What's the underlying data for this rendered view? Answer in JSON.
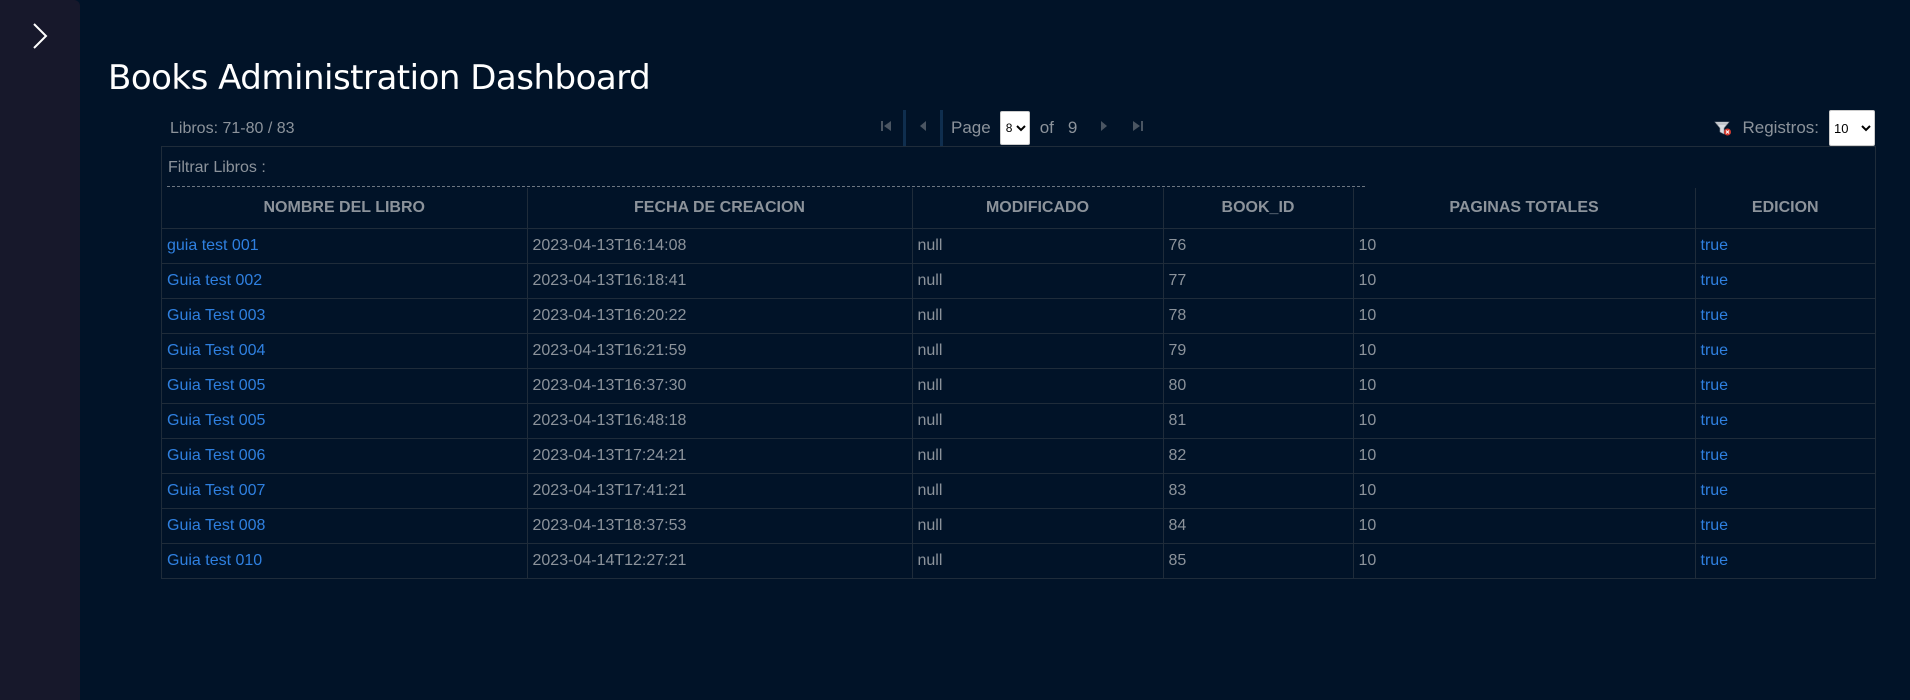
{
  "title": "Books Administration Dashboard",
  "toolbar": {
    "count_label": "Libros: 71-80 / 83",
    "page_label": "Page",
    "current_page": "8",
    "of_label": "of",
    "total_pages": "9",
    "records_label": "Registros:",
    "records_value": "10"
  },
  "filter": {
    "label": "Filtrar Libros :"
  },
  "columns": [
    "NOMBRE DEL LIBRO",
    "FECHA DE CREACION",
    "MODIFICADO",
    "BOOK_ID",
    "PAGINAS TOTALES",
    "EDICION"
  ],
  "rows": [
    {
      "name": "guia test 001",
      "created": "2023-04-13T16:14:08",
      "modified": "null",
      "book_id": "76",
      "pages": "10",
      "edition": "true"
    },
    {
      "name": "Guia test 002",
      "created": "2023-04-13T16:18:41",
      "modified": "null",
      "book_id": "77",
      "pages": "10",
      "edition": "true"
    },
    {
      "name": "Guia Test 003",
      "created": "2023-04-13T16:20:22",
      "modified": "null",
      "book_id": "78",
      "pages": "10",
      "edition": "true"
    },
    {
      "name": "Guia Test 004",
      "created": "2023-04-13T16:21:59",
      "modified": "null",
      "book_id": "79",
      "pages": "10",
      "edition": "true"
    },
    {
      "name": "Guia Test 005",
      "created": "2023-04-13T16:37:30",
      "modified": "null",
      "book_id": "80",
      "pages": "10",
      "edition": "true"
    },
    {
      "name": "Guia Test 005",
      "created": "2023-04-13T16:48:18",
      "modified": "null",
      "book_id": "81",
      "pages": "10",
      "edition": "true"
    },
    {
      "name": "Guia Test 006",
      "created": "2023-04-13T17:24:21",
      "modified": "null",
      "book_id": "82",
      "pages": "10",
      "edition": "true"
    },
    {
      "name": "Guia Test 007",
      "created": "2023-04-13T17:41:21",
      "modified": "null",
      "book_id": "83",
      "pages": "10",
      "edition": "true"
    },
    {
      "name": "Guia Test 008",
      "created": "2023-04-13T18:37:53",
      "modified": "null",
      "book_id": "84",
      "pages": "10",
      "edition": "true"
    },
    {
      "name": "Guia test 010",
      "created": "2023-04-14T12:27:21",
      "modified": "null",
      "book_id": "85",
      "pages": "10",
      "edition": "true"
    }
  ],
  "icons": {
    "expand": "chevron-right-icon",
    "first": "first-page-icon",
    "prev": "prev-page-icon",
    "next": "next-page-icon",
    "last": "last-page-icon",
    "clear_filter": "clear-filter-icon"
  },
  "colors": {
    "background": "#011328",
    "sidebar": "#17182b",
    "link": "#2f80e0",
    "text": "#8c939b",
    "title": "#ffffff"
  }
}
